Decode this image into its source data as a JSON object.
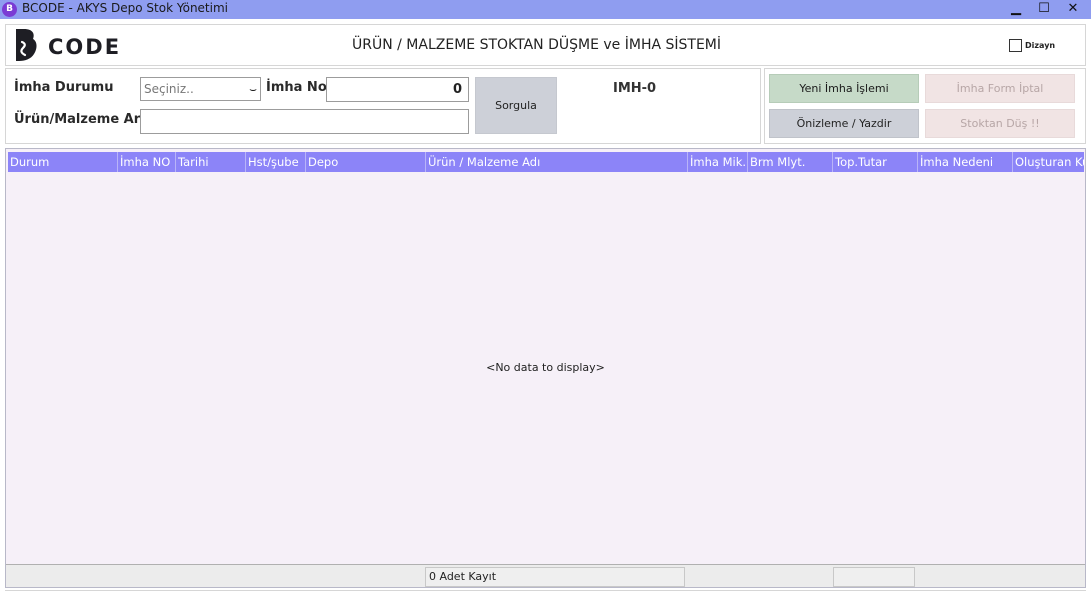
{
  "window": {
    "app_icon_letter": "B",
    "title": "BCODE - AKYS Depo Stok Yönetimi",
    "minimize": "▁",
    "maximize": "☐",
    "close": "✕"
  },
  "header": {
    "logo_text": "CODE",
    "title": "ÜRÜN / MALZEME STOKTAN DÜŞME ve İMHA SİSTEMİ",
    "dizayn_label": "Dizayn"
  },
  "filters": {
    "imha_durumu_label": "İmha Durumu",
    "imha_durumu_value": "Seçiniz..",
    "imha_no_label": "İmha No",
    "imha_no_value": "0",
    "search_label": "Ürün/Malzeme Ara",
    "search_value": "",
    "query_button": "Sorgula",
    "imha_code": "IMH-0"
  },
  "actions": {
    "new_label": "Yeni İmha İşlemi",
    "cancel_label": "İmha Form İptal",
    "preview_label": "Önizleme / Yazdir",
    "drop_label": "Stoktan Düş !!"
  },
  "grid": {
    "columns": [
      "Durum",
      "İmha NO",
      "Tarihi",
      "Hst/şube",
      "Depo",
      "Ürün / Malzeme Adı",
      "İmha Mik.",
      "Brm Mlyt.",
      "Top.Tutar",
      "İmha Nedeni",
      "Oluşturan Ku"
    ],
    "empty_text": "<No data to display>",
    "footer_count": "0 Adet Kayıt"
  },
  "colors": {
    "titlebar": "#8f9df0",
    "grid_header": "#8c84f8",
    "new_button": "#c6dac8",
    "disabled_button": "#f1e4e4"
  }
}
